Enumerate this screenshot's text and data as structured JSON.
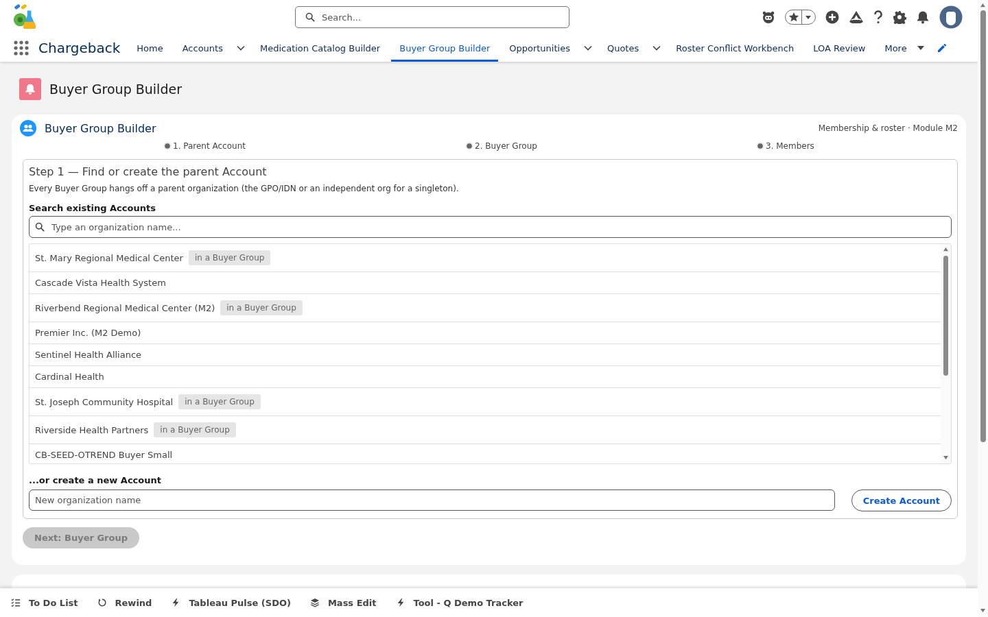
{
  "app": {
    "name": "Chargeback"
  },
  "search": {
    "placeholder": "Search..."
  },
  "nav": {
    "items": [
      {
        "label": "Home",
        "selected": false,
        "dropdown": false
      },
      {
        "label": "Accounts",
        "selected": false,
        "dropdown": true
      },
      {
        "label": "Medication Catalog Builder",
        "selected": false,
        "dropdown": false
      },
      {
        "label": "Buyer Group Builder",
        "selected": true,
        "dropdown": false
      },
      {
        "label": "Opportunities",
        "selected": false,
        "dropdown": true
      },
      {
        "label": "Quotes",
        "selected": false,
        "dropdown": true
      },
      {
        "label": "Roster Conflict Workbench",
        "selected": false,
        "dropdown": false
      },
      {
        "label": "LOA Review",
        "selected": false,
        "dropdown": false
      }
    ],
    "more": "More"
  },
  "page_header": {
    "title": "Buyer Group Builder"
  },
  "card": {
    "title": "Buyer Group Builder",
    "meta": "Membership & roster · Module M2",
    "steps": [
      {
        "label": "1. Parent Account"
      },
      {
        "label": "2. Buyer Group"
      },
      {
        "label": "3. Members"
      }
    ],
    "panel": {
      "heading": "Step 1 — Find or create the parent Account",
      "description": "Every Buyer Group hangs off a parent organization (the GPO/IDN or an independent org for a singleton).",
      "search_label": "Search existing Accounts",
      "search_placeholder": "Type an organization name...",
      "accounts": [
        {
          "name": "St. Mary Regional Medical Center",
          "badge": "in a Buyer Group"
        },
        {
          "name": "Cascade Vista Health System"
        },
        {
          "name": "Riverbend Regional Medical Center (M2)",
          "badge": "in a Buyer Group"
        },
        {
          "name": "Premier Inc. (M2 Demo)"
        },
        {
          "name": "Sentinel Health Alliance"
        },
        {
          "name": "Cardinal Health"
        },
        {
          "name": "St. Joseph Community Hospital",
          "badge": "in a Buyer Group"
        },
        {
          "name": "Riverside Health Partners",
          "badge": "in a Buyer Group"
        },
        {
          "name": "CB-SEED-OTREND Buyer Small"
        }
      ],
      "create_label": "...or create a new Account",
      "create_placeholder": "New organization name",
      "create_button": "Create Account"
    },
    "next_button": {
      "label": "Next: Buyer Group",
      "disabled": true
    }
  },
  "utility_bar": [
    {
      "label": "To Do List",
      "kind": "checklist"
    },
    {
      "label": "Rewind",
      "kind": "rewind"
    },
    {
      "label": "Tableau Pulse (SDO)",
      "kind": "bolt"
    },
    {
      "label": "Mass Edit",
      "kind": "layers"
    },
    {
      "label": "Tool - Q Demo Tracker",
      "kind": "bolt"
    }
  ]
}
